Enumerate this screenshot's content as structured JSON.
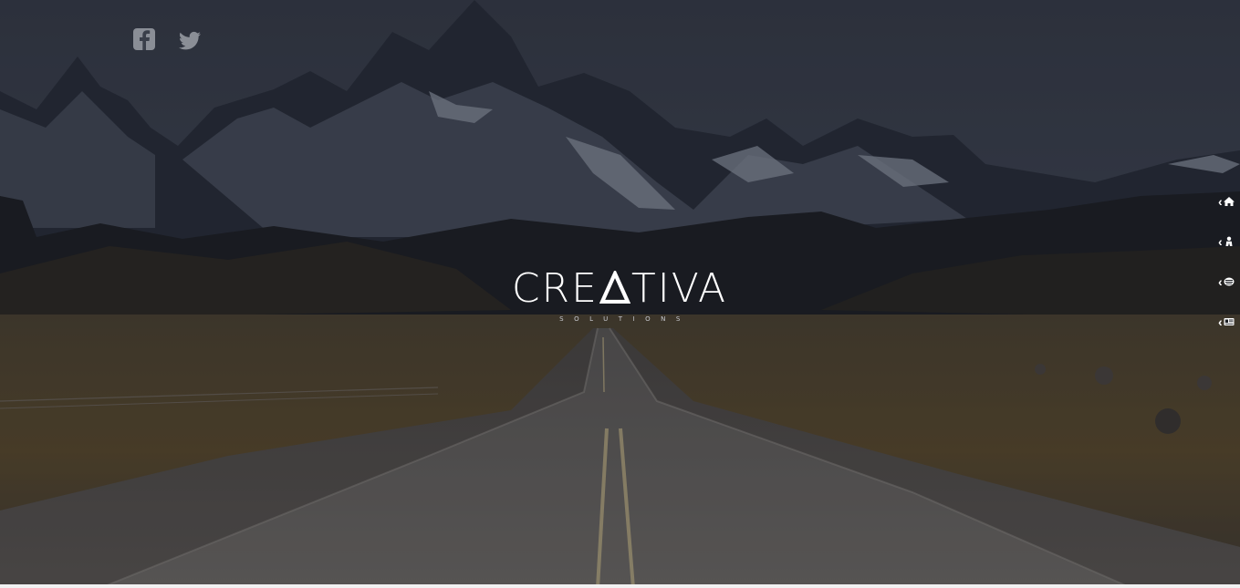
{
  "brand": {
    "name_part1": "CRE",
    "name_part2": "TIVA",
    "tagline": "SOLUTIONS"
  },
  "social": [
    {
      "icon": "facebook-icon"
    },
    {
      "icon": "twitter-icon"
    }
  ],
  "sidenav": [
    {
      "icon": "home-icon"
    },
    {
      "icon": "user-icon"
    },
    {
      "icon": "services-icon"
    },
    {
      "icon": "contact-card-icon"
    }
  ],
  "colors": {
    "sky": "#3a4150",
    "grass": "#5c4e30",
    "road": "#6b6864",
    "text": "#ffffff"
  }
}
